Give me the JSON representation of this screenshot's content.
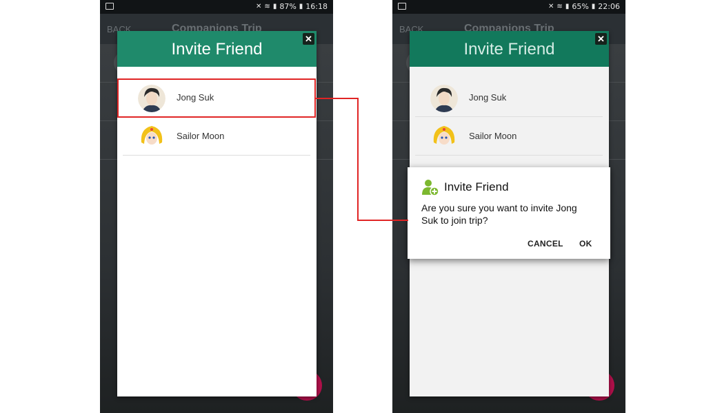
{
  "left_screen": {
    "status": {
      "battery": "87%",
      "time": "16:18"
    },
    "header": {
      "back": "BACK",
      "title": "Companions Trip"
    },
    "modal": {
      "title": "Invite Friend",
      "friends": [
        {
          "name": "Jong Suk"
        },
        {
          "name": "Sailor Moon"
        }
      ]
    }
  },
  "right_screen": {
    "status": {
      "battery": "65%",
      "time": "22:06"
    },
    "header": {
      "back": "BACK",
      "title": "Companions Trip"
    },
    "modal": {
      "title": "Invite Friend",
      "friends": [
        {
          "name": "Jong Suk"
        },
        {
          "name": "Sailor Moon"
        }
      ]
    },
    "dialog": {
      "title": "Invite Friend",
      "message": "Are you sure you want to invite Jong Suk to join trip?",
      "cancel": "CANCEL",
      "ok": "OK"
    }
  },
  "colors": {
    "modal_header": "#1f8a6b",
    "highlight": "#e02424",
    "fab": "#b0104a",
    "dialog_icon": "#7cb82f"
  }
}
